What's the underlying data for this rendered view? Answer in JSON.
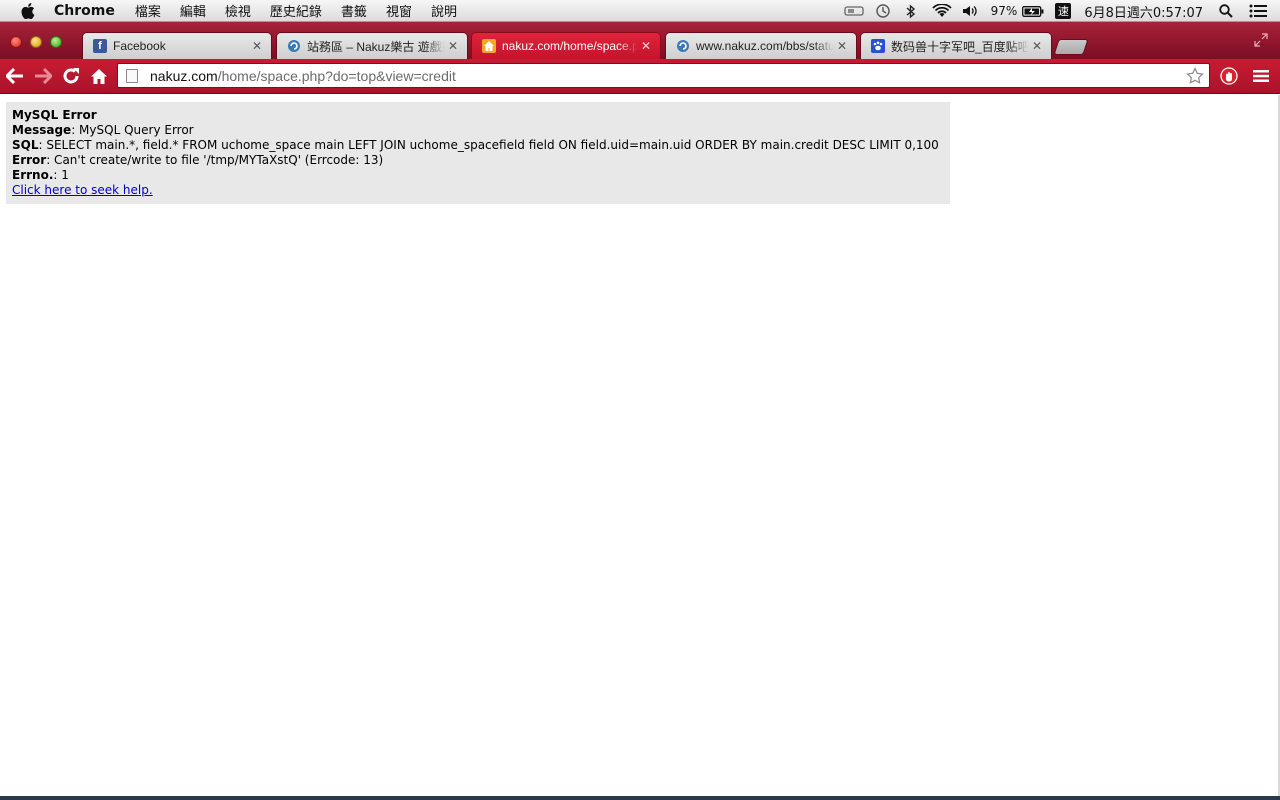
{
  "menubar": {
    "app_name": "Chrome",
    "menus": [
      "檔案",
      "編輯",
      "檢視",
      "歷史紀錄",
      "書籤",
      "視窗",
      "說明"
    ],
    "battery": "97%",
    "input_method": "速",
    "clock": "6月8日週六0:57:07"
  },
  "tabs": [
    {
      "title": "Facebook",
      "favicon": "facebook-icon",
      "active": false
    },
    {
      "title": "站務區 – Nakuz樂古 遊戲娛樂",
      "favicon": "globe-icon",
      "active": false
    },
    {
      "title": "nakuz.com/home/space.php",
      "favicon": "home-icon",
      "active": true
    },
    {
      "title": "www.nakuz.com/bbs/status",
      "favicon": "globe-icon",
      "active": false
    },
    {
      "title": "数码兽十字军吧_百度贴吧",
      "favicon": "baidu-paw-icon",
      "active": false
    }
  ],
  "omnibox": {
    "host": "nakuz.com",
    "path": "/home/space.php?do=top&view=credit"
  },
  "error": {
    "title": "MySQL Error",
    "message_label": "Message",
    "message": ": MySQL Query Error",
    "sql_label": "SQL",
    "sql": ": SELECT main.*, field.* FROM uchome_space main LEFT JOIN uchome_spacefield field ON field.uid=main.uid ORDER BY main.credit DESC LIMIT 0,100",
    "error_label": "Error",
    "error": ": Can't create/write to file '/tmp/MYTaXstQ' (Errcode: 13)",
    "errno_label": "Errno.",
    "errno": ": 1",
    "help_link": "Click here to seek help."
  },
  "colors": {
    "theme_red": "#c3142c",
    "error_bg": "#e8e8e8",
    "link": "#0000cc"
  }
}
